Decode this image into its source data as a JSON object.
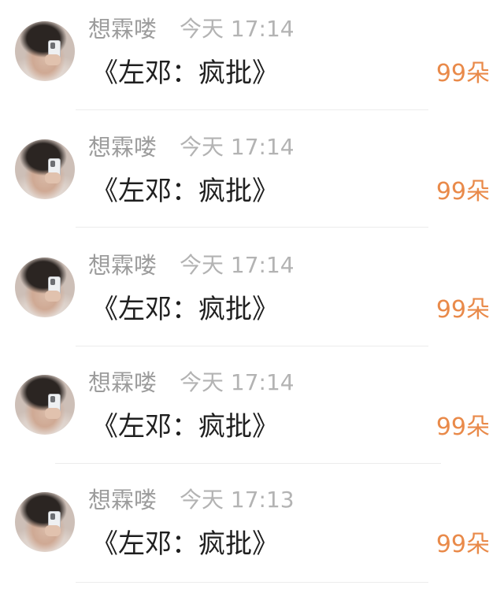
{
  "messages": [
    {
      "user": "想霖喽",
      "time": "今天 17:14",
      "text": "《左邓：疯批》",
      "gift": "99朵"
    },
    {
      "user": "想霖喽",
      "time": "今天 17:14",
      "text": "《左邓：疯批》",
      "gift": "99朵"
    },
    {
      "user": "想霖喽",
      "time": "今天 17:14",
      "text": "《左邓：疯批》",
      "gift": "99朵"
    },
    {
      "user": "想霖喽",
      "time": "今天 17:14",
      "text": "《左邓：疯批》",
      "gift": "99朵"
    },
    {
      "user": "想霖喽",
      "time": "今天 17:13",
      "text": "《左邓：疯批》",
      "gift": "99朵"
    }
  ],
  "colors": {
    "name": "#9c9c9c",
    "time": "#b3b3b3",
    "text": "#1f1f1f",
    "gift": "#e98a4a",
    "divider": "#ececec"
  }
}
